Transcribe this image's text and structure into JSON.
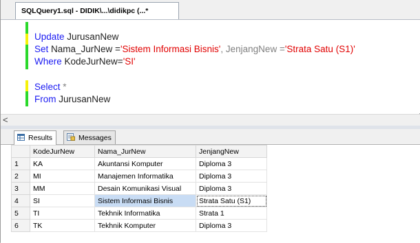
{
  "window": {
    "tab_title": "SQLQuery1.sql - DIDIK\\...\\didikpc (...*"
  },
  "editor": {
    "line1": {
      "kw": "Update",
      "rest": " JurusanNew"
    },
    "line2": {
      "kw_set": "Set",
      "p1": " Nama_JurNew =",
      "s1": "'Sistem Informasi Bisnis'",
      "p2": ", JenjangNew =",
      "s2": "'Strata Satu (S1)'"
    },
    "line3": {
      "kw": "Where",
      "p1": " KodeJurNew=",
      "s1": "'SI'"
    },
    "line4": {
      "kw": "Select",
      "star": " *"
    },
    "line5": {
      "kw": "From",
      "rest": " JurusanNew"
    },
    "scroll_arrow": "<"
  },
  "results": {
    "tabs": [
      {
        "label": "Results",
        "icon": "grid-icon"
      },
      {
        "label": "Messages",
        "icon": "message-icon"
      }
    ],
    "columns": [
      "KodeJurNew",
      "Nama_JurNew",
      "JenjangNew"
    ],
    "rows": [
      {
        "n": "1",
        "c1": "KA",
        "c2": "Akuntansi Komputer",
        "c3": "Diploma 3"
      },
      {
        "n": "2",
        "c1": "MI",
        "c2": "Manajemen Informatika",
        "c3": "Diploma 3"
      },
      {
        "n": "3",
        "c1": "MM",
        "c2": "Desain Komunikasi Visual",
        "c3": "Diploma 3"
      },
      {
        "n": "4",
        "c1": "SI",
        "c2": "Sistem Informasi Bisnis",
        "c3": "Strata Satu (S1)"
      },
      {
        "n": "5",
        "c1": "TI",
        "c2": "Tekhnik Informatika",
        "c3": "Strata 1"
      },
      {
        "n": "6",
        "c1": "TK",
        "c2": "Tekhnik Komputer",
        "c3": "Diploma 3"
      }
    ]
  }
}
